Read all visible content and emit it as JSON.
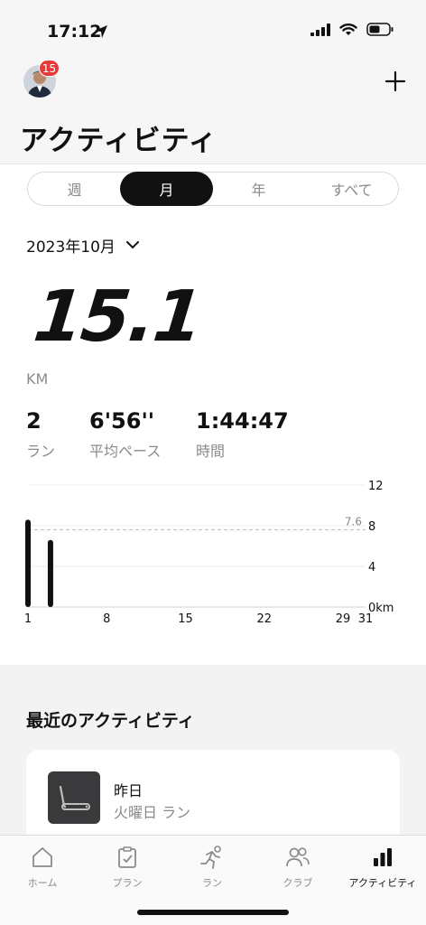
{
  "status_bar": {
    "time": "17:12"
  },
  "header": {
    "badge_count": "15",
    "title": "アクティビティ"
  },
  "segments": [
    {
      "label": "週",
      "active": false
    },
    {
      "label": "月",
      "active": true
    },
    {
      "label": "年",
      "active": false
    },
    {
      "label": "すべて",
      "active": false
    }
  ],
  "period": {
    "label": "2023年10月"
  },
  "summary": {
    "distance": "15.1",
    "unit": "KM",
    "runs_value": "2",
    "runs_label": "ラン",
    "pace_value": "6'56''",
    "pace_label": "平均ペース",
    "time_value": "1:44:47",
    "time_label": "時間"
  },
  "chart_data": {
    "type": "bar",
    "x": [
      1,
      3
    ],
    "values": [
      8.6,
      6.6
    ],
    "x_ticks": [
      "1",
      "8",
      "15",
      "22",
      "29",
      "31"
    ],
    "y_ticks": [
      "12",
      "8",
      "4",
      "0km"
    ],
    "ylim": [
      0,
      12
    ],
    "xlim": [
      1,
      31
    ],
    "average": 7.6,
    "average_label": "7.6",
    "grid": true
  },
  "recent": {
    "title": "最近のアクティビティ",
    "item_title": "昨日",
    "item_subtitle": "火曜日 ラン"
  },
  "tabbar": [
    {
      "label": "ホーム",
      "icon": "home-icon",
      "active": false
    },
    {
      "label": "プラン",
      "icon": "clipboard-icon",
      "active": false
    },
    {
      "label": "ラン",
      "icon": "runner-icon",
      "active": false
    },
    {
      "label": "クラブ",
      "icon": "people-icon",
      "active": false
    },
    {
      "label": "アクティビティ",
      "icon": "bar-chart-icon",
      "active": true
    }
  ]
}
